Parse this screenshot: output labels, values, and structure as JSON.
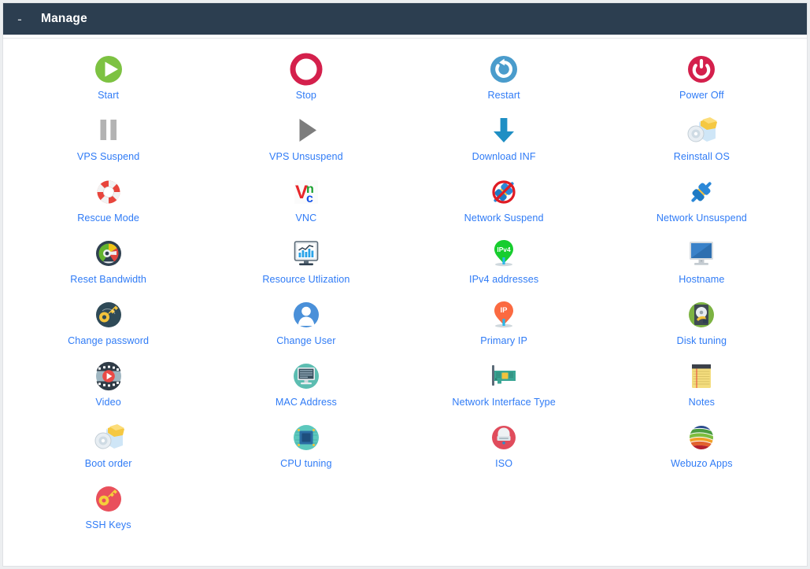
{
  "window": {
    "panel_title": "Manage",
    "collapse_label": "-",
    "header_bg": "#2c3e50",
    "label_color": "#2f7bf6",
    "panel_bg": "#ffffff",
    "page_bg": "#eceef0"
  },
  "grid": {
    "columns": 4,
    "items": [
      {
        "label": "Start",
        "icon": "play-circle-green-icon"
      },
      {
        "label": "Stop",
        "icon": "stop-circle-red-icon"
      },
      {
        "label": "Restart",
        "icon": "restart-circle-blue-icon"
      },
      {
        "label": "Power Off",
        "icon": "power-circle-red-icon"
      },
      {
        "label": "VPS Suspend",
        "icon": "pause-grey-icon"
      },
      {
        "label": "VPS Unsuspend",
        "icon": "play-triangle-grey-icon"
      },
      {
        "label": "Download INF",
        "icon": "download-arrow-blue-icon"
      },
      {
        "label": "Reinstall OS",
        "icon": "disc-folder-icon"
      },
      {
        "label": "Rescue Mode",
        "icon": "lifebuoy-icon"
      },
      {
        "label": "VNC",
        "icon": "vnc-logo-icon"
      },
      {
        "label": "Network Suspend",
        "icon": "plug-disabled-icon"
      },
      {
        "label": "Network Unsuspend",
        "icon": "plug-connected-icon"
      },
      {
        "label": "Reset Bandwidth",
        "icon": "speedometer-icon"
      },
      {
        "label": "Resource Utlization",
        "icon": "monitor-chart-icon"
      },
      {
        "label": "IPv4 addresses",
        "icon": "ipv4-map-pin-icon"
      },
      {
        "label": "Hostname",
        "icon": "monitor-blue-icon"
      },
      {
        "label": "Change password",
        "icon": "key-dark-circle-icon"
      },
      {
        "label": "Change User",
        "icon": "user-circle-blue-icon"
      },
      {
        "label": "Primary IP",
        "icon": "ip-map-pin-icon"
      },
      {
        "label": "Disk tuning",
        "icon": "harddisk-green-circle-icon"
      },
      {
        "label": "Video",
        "icon": "film-play-icon"
      },
      {
        "label": "MAC Address",
        "icon": "monitor-teal-circle-icon"
      },
      {
        "label": "Network Interface Type",
        "icon": "network-card-icon"
      },
      {
        "label": "Notes",
        "icon": "notepad-yellow-icon"
      },
      {
        "label": "Boot order",
        "icon": "disc-folder-icon"
      },
      {
        "label": "CPU tuning",
        "icon": "cpu-chip-circle-icon"
      },
      {
        "label": "ISO",
        "icon": "iso-disc-drive-red-icon"
      },
      {
        "label": "Webuzo Apps",
        "icon": "webuzo-globe-icon"
      },
      {
        "label": "SSH Keys",
        "icon": "key-red-circle-icon"
      }
    ]
  }
}
